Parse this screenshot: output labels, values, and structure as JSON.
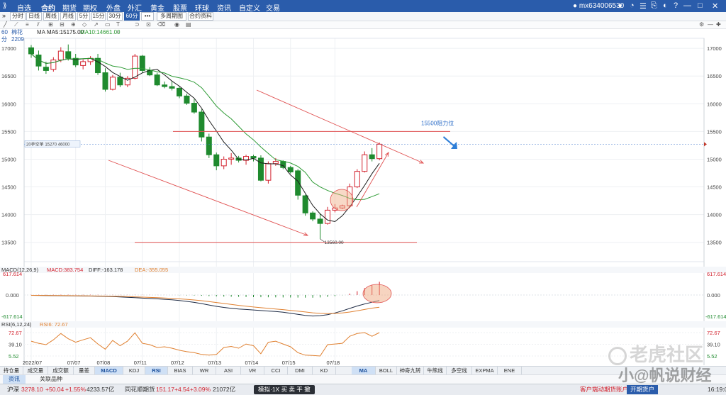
{
  "menu": {
    "items": [
      "自选",
      "合约",
      "期货",
      "期权",
      "外盘",
      "外汇",
      "黄金",
      "股票",
      "环球",
      "资讯",
      "自定义",
      "交易"
    ],
    "active_index": 1,
    "user": "mx634006530",
    "window_controls": [
      "□",
      "—",
      "□",
      "✕"
    ]
  },
  "toolbar": {
    "buttons": [
      "分时",
      "日线",
      "周线",
      "月线",
      "5分",
      "15分",
      "30分",
      "60分",
      "•••",
      "多周期图",
      "合约资料"
    ],
    "selected": "60分"
  },
  "info": {
    "period": "60分",
    "symbol": "棉花2209",
    "ma5": "MA5:15175.00",
    "ma10": "MA10:14661.00",
    "price_tag": "20手空单 15270 46000"
  },
  "colors": {
    "up": "#d3232f",
    "down": "#1f8a2e",
    "ma5": "#1d1d1d",
    "ma10": "#2e9b35",
    "annotation": "#e05050",
    "blue_arrow": "#2f7fd8",
    "menubar": "#2a5cab"
  },
  "chart_data": [
    {
      "type": "candlestick",
      "title": "",
      "xlabel": "",
      "ylabel": "",
      "ylim": [
        13330,
        17130
      ],
      "yticks": [
        13500,
        14000,
        14500,
        15000,
        15500,
        16000,
        16500,
        17000
      ],
      "x_labels": [
        {
          "index": 0,
          "label": "2022/07"
        },
        {
          "index": 6,
          "label": "07/07"
        },
        {
          "index": 10,
          "label": "07/08"
        },
        {
          "index": 15,
          "label": "07/11"
        },
        {
          "index": 20,
          "label": "07/12"
        },
        {
          "index": 25,
          "label": "07/13"
        },
        {
          "index": 30,
          "label": "07/14"
        },
        {
          "index": 35,
          "label": "07/15"
        },
        {
          "index": 41,
          "label": "07/18"
        }
      ],
      "ohlc": [
        [
          17010,
          17060,
          16830,
          16900
        ],
        [
          16880,
          16960,
          16600,
          16680
        ],
        [
          16660,
          16760,
          16540,
          16600
        ],
        [
          16620,
          16840,
          16580,
          16790
        ],
        [
          16790,
          17020,
          16750,
          16950
        ],
        [
          16940,
          17070,
          16780,
          16820
        ],
        [
          16820,
          16900,
          16660,
          16700
        ],
        [
          16690,
          16800,
          16620,
          16760
        ],
        [
          16760,
          16860,
          16700,
          16820
        ],
        [
          16820,
          16900,
          16520,
          16560
        ],
        [
          16560,
          16640,
          16220,
          16260
        ],
        [
          16260,
          16520,
          16240,
          16480
        ],
        [
          16480,
          16560,
          16300,
          16340
        ],
        [
          16340,
          16500,
          16300,
          16460
        ],
        [
          16460,
          16900,
          16440,
          16860
        ],
        [
          16860,
          16880,
          16560,
          16600
        ],
        [
          16600,
          16660,
          16500,
          16520
        ],
        [
          16520,
          16560,
          16320,
          16340
        ],
        [
          16340,
          16400,
          16280,
          16310
        ],
        [
          16310,
          16400,
          16240,
          16280
        ],
        [
          16280,
          16310,
          16100,
          16140
        ],
        [
          16140,
          16180,
          15980,
          16010
        ],
        [
          16010,
          16080,
          15820,
          15850
        ],
        [
          15850,
          15900,
          15320,
          15400
        ],
        [
          15400,
          15460,
          15020,
          15080
        ],
        [
          15080,
          15120,
          14800,
          14880
        ],
        [
          14880,
          15050,
          14820,
          15000
        ],
        [
          15000,
          15110,
          14900,
          15020
        ],
        [
          15020,
          15060,
          14940,
          14980
        ],
        [
          14980,
          15080,
          14900,
          15050
        ],
        [
          15050,
          15080,
          14960,
          15020
        ],
        [
          15020,
          15070,
          14600,
          14620
        ],
        [
          14620,
          14960,
          14560,
          14920
        ],
        [
          14920,
          15020,
          14880,
          14960
        ],
        [
          14960,
          14980,
          14820,
          14850
        ],
        [
          14850,
          14880,
          14740,
          14770
        ],
        [
          14790,
          14820,
          14270,
          14350
        ],
        [
          14340,
          14360,
          13980,
          14030
        ],
        [
          14030,
          14060,
          13880,
          13920
        ],
        [
          13920,
          14020,
          13560,
          13840
        ],
        [
          13840,
          14140,
          13820,
          14080
        ],
        [
          14080,
          14190,
          14040,
          14120
        ],
        [
          14120,
          14180,
          14100,
          14160
        ],
        [
          14160,
          14560,
          14140,
          14500
        ],
        [
          14500,
          14820,
          14480,
          14780
        ],
        [
          14780,
          15140,
          14760,
          15080
        ],
        [
          15080,
          15200,
          14960,
          15010
        ],
        [
          15010,
          15300,
          14980,
          15270
        ]
      ],
      "ma5": [
        16900,
        16790,
        16727,
        16742,
        16784,
        16810,
        16796,
        16812,
        16818,
        16757,
        16672,
        16565,
        16493,
        16424,
        16482,
        16557,
        16602,
        16621,
        16521,
        16410,
        16318,
        16208,
        16100,
        15919,
        15698,
        15507,
        15308,
        15164,
        14996,
        14986,
        15014,
        14934,
        14916,
        14916,
        14884,
        14714,
        14603,
        14386,
        14165,
        14014,
        13902,
        13874,
        13980,
        14142,
        14328,
        14528,
        14740,
        14926
      ],
      "ma10": [
        16900,
        16790,
        16727,
        16742,
        16784,
        16810,
        16810,
        16814,
        16819,
        16801,
        16735,
        16681,
        16660,
        16620,
        16640,
        16639,
        16611,
        16578,
        16556,
        16497,
        16468,
        16437,
        16389,
        16290,
        16128,
        15958,
        15833,
        15729,
        15594,
        15457,
        15349,
        15221,
        15103,
        14991,
        14962,
        14931,
        14869,
        14762,
        14587,
        14500,
        14435,
        14385,
        14345,
        14292,
        14269,
        14276,
        14326,
        14377
      ],
      "annotations": {
        "resistance_label": "15500阻力位",
        "resistance_level": 15500,
        "support_label": "13560.00",
        "support_level": 13500,
        "current_price_level": 15270
      }
    },
    {
      "type": "bar",
      "title": "MACD(12,26,9)",
      "series": [
        {
          "name": "MACD",
          "label": "MACD:383.754"
        },
        {
          "name": "DIFF",
          "label": "DIFF:-163.178"
        },
        {
          "name": "DEA",
          "label": "DEA:-355.055"
        }
      ],
      "yticks": [
        617.614,
        0.0,
        -617.614
      ],
      "ylim": [
        -617.614,
        617.614
      ],
      "macd": [
        5,
        6,
        6,
        7,
        8,
        8,
        7,
        7,
        8,
        6,
        5,
        5,
        4,
        4,
        5,
        5,
        4,
        3,
        2,
        0,
        -5,
        -9,
        -14,
        -22,
        -32,
        -40,
        -46,
        -50,
        -54,
        -58,
        -62,
        -64,
        -66,
        -68,
        -70,
        -72,
        -74,
        -76,
        -78,
        -70,
        -55,
        -35,
        -5,
        40,
        110,
        200,
        300,
        383.754
      ],
      "diff": [
        -10,
        -12,
        -15,
        -18,
        -20,
        -22,
        -25,
        -28,
        -30,
        -34,
        -40,
        -48,
        -58,
        -68,
        -78,
        -90,
        -100,
        -112,
        -125,
        -140,
        -160,
        -185,
        -215,
        -250,
        -290,
        -330,
        -360,
        -385,
        -405,
        -420,
        -435,
        -450,
        -465,
        -480,
        -500,
        -530,
        -560,
        -590,
        -610,
        -600,
        -570,
        -520,
        -460,
        -390,
        -320,
        -260,
        -210,
        -163.178
      ],
      "dea": [
        -10,
        -11,
        -13,
        -15,
        -17,
        -19,
        -21,
        -23,
        -25,
        -28,
        -31,
        -35,
        -40,
        -47,
        -53,
        -61,
        -69,
        -78,
        -88,
        -99,
        -111,
        -126,
        -144,
        -165,
        -190,
        -218,
        -246,
        -274,
        -301,
        -325,
        -347,
        -368,
        -387,
        -406,
        -425,
        -446,
        -469,
        -493,
        -516,
        -533,
        -540,
        -536,
        -521,
        -495,
        -460,
        -420,
        -380,
        -355.055
      ]
    },
    {
      "type": "line",
      "title": "RSI(6,12,24)",
      "series": [
        {
          "name": "RSI6",
          "label": "RSI6: 72.67"
        }
      ],
      "yticks": [
        72.67,
        39.1,
        5.52
      ],
      "ylim": [
        5.52,
        72.67
      ],
      "values": [
        48,
        42,
        38,
        52,
        70,
        55,
        45,
        52,
        58,
        40,
        25,
        50,
        35,
        48,
        72,
        42,
        38,
        30,
        32,
        28,
        22,
        18,
        15,
        10,
        8,
        10,
        30,
        33,
        28,
        40,
        35,
        12,
        45,
        48,
        40,
        32,
        15,
        8,
        7,
        5.52,
        38,
        40,
        42,
        62,
        70,
        72.67,
        62,
        72.67
      ]
    }
  ],
  "tabs": [
    "持仓量",
    "成交量",
    "成交额",
    "量差",
    "MACD",
    "KDJ",
    "RSI",
    "BIAS",
    "WR",
    "ASI",
    "VR",
    "CCI",
    "DMI",
    "KD",
    "MA",
    "BOLL",
    "神奇九转",
    "牛熊线",
    "多空线",
    "EXPMA",
    "ENE"
  ],
  "selected_tabs": [
    "MACD",
    "RSI",
    "MA"
  ],
  "subtabs": [
    "资讯",
    "关联品种"
  ],
  "ticker": {
    "name1": "沪深",
    "value1": "3278.10",
    "chg1": "+50.04",
    "pct1": "+1.55%",
    "amt1": "4233.57亿",
    "name2": "同花顺期货",
    "value2": "151.17",
    "chg2": "+4.54",
    "pct2": "+3.09%",
    "amt2": "21072亿",
    "controls": "模拟·1X 买 卖 平 撤",
    "account_label": "客户端动期货账户",
    "open_btn": "开期货户",
    "time": "16:19:0"
  },
  "watermark": {
    "line1": "老虎社区",
    "line2": "小@帆说财经"
  }
}
